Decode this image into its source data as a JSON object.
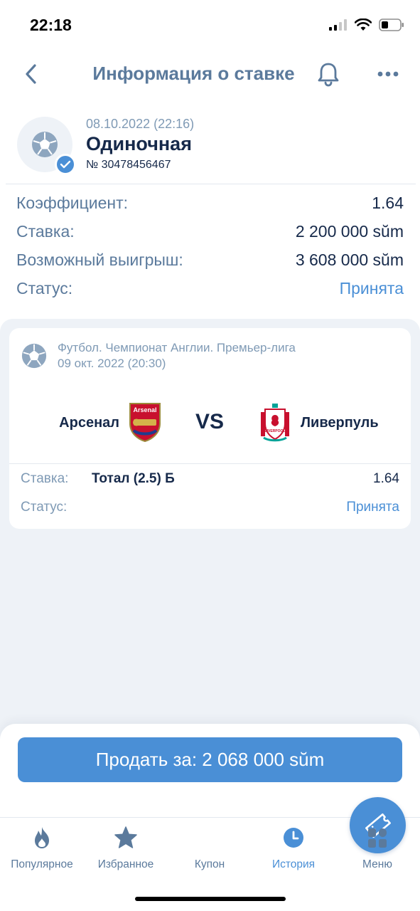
{
  "status_bar": {
    "time": "22:18"
  },
  "nav": {
    "title": "Информация о ставке"
  },
  "bet": {
    "date": "08.10.2022 (22:16)",
    "type": "Одиночная",
    "number": "№ 30478456467"
  },
  "info": {
    "rows": [
      {
        "label": "Коэффициент:",
        "value": "1.64"
      },
      {
        "label": "Ставка:",
        "value": "2 200 000 sŭm"
      },
      {
        "label": "Возможный выигрыш:",
        "value": "3 608 000 sŭm"
      },
      {
        "label": "Статус:",
        "value": "Принята"
      }
    ]
  },
  "event": {
    "league": "Футбол. Чемпионат Англии. Премьер-лига",
    "date": "09 окт. 2022 (20:30)",
    "team1": "Арсенал",
    "vs": "VS",
    "team2": "Ливерпуль",
    "team1_logo_text": "Arsenal",
    "team2_logo_text": "LIVERPOOL",
    "pick_label": "Ставка:",
    "pick_value": "Тотал (2.5) Б",
    "pick_odds": "1.64",
    "status_label": "Статус:",
    "status_value": "Принята"
  },
  "sell": {
    "label": "Продать за: 2 068 000 sŭm"
  },
  "tabs": [
    {
      "label": "Популярное",
      "icon": "flame-icon"
    },
    {
      "label": "Избранное",
      "icon": "star-icon"
    },
    {
      "label": "Купон",
      "icon": "ticket-icon"
    },
    {
      "label": "История",
      "icon": "clock-icon"
    },
    {
      "label": "Меню",
      "icon": "grid-icon"
    }
  ],
  "colors": {
    "accent": "#4a8fd6",
    "text_dark": "#16294a",
    "text_muted": "#5b7a9c",
    "background_gray": "#eef2f7"
  }
}
